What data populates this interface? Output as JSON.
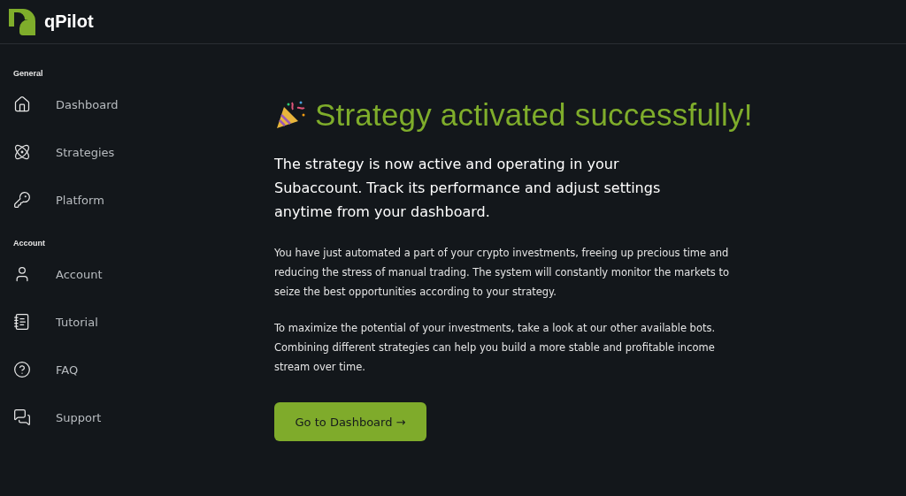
{
  "brand": {
    "name": "qPilot"
  },
  "sidebar": {
    "sections": [
      {
        "label": "General",
        "items": [
          {
            "label": "Dashboard"
          },
          {
            "label": "Strategies"
          },
          {
            "label": "Platform"
          }
        ]
      },
      {
        "label": "Account",
        "items": [
          {
            "label": "Account"
          },
          {
            "label": "Tutorial"
          },
          {
            "label": "FAQ"
          },
          {
            "label": "Support"
          }
        ]
      }
    ]
  },
  "main": {
    "title": "Strategy activated successfully!",
    "lead": "The strategy is now active and operating in your Subaccount. Track its performance and adjust settings anytime from your dashboard.",
    "paragraphs": [
      "You have just automated a part of your crypto investments, freeing up precious time and reducing the stress of manual trading. The system will constantly monitor the markets to seize the best opportunities according to your strategy.",
      "To maximize the potential of your investments, take a look at our other available bots. Combining different strategies can help you build a more stable and profitable income stream over time."
    ],
    "button": {
      "label": "Go to Dashboard →"
    }
  }
}
